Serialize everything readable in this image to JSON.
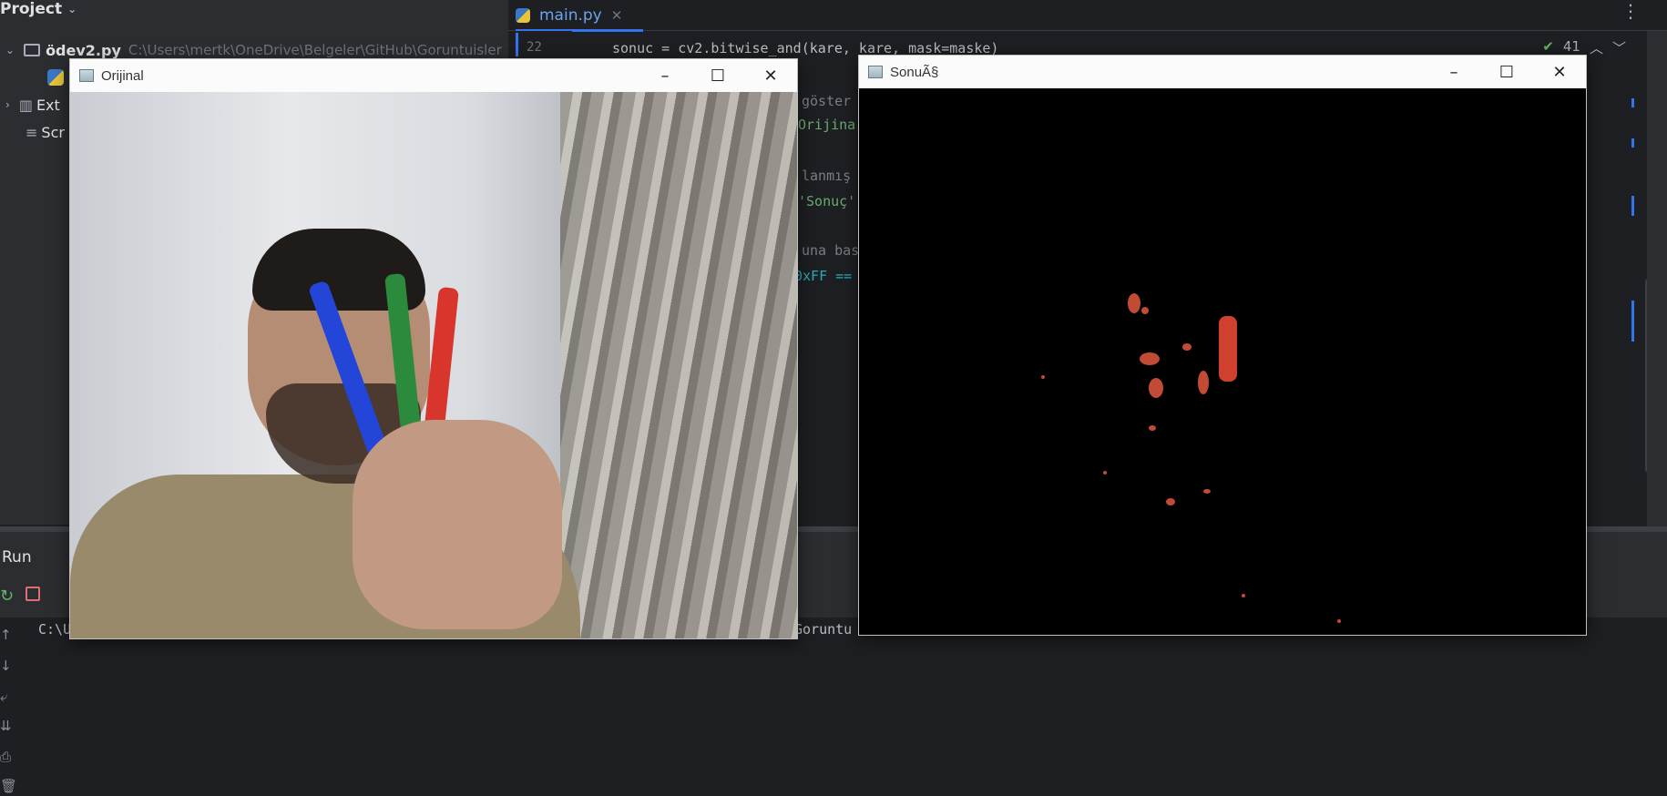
{
  "project": {
    "header": "Project",
    "root_name": "ödev2.py",
    "root_path": "C:\\Users\\mertk\\OneDrive\\Belgeler\\GitHub\\Goruntuisler",
    "ext_label": "Ext",
    "scr_label": "Scr"
  },
  "editor": {
    "tab_label": "main.py",
    "line_number": "22",
    "code_line": "sonuc = cv2.bitwise_and(kare, kare, mask=maske)",
    "inspection_count": "41",
    "fragments": [
      "göster",
      "Orijina",
      "lanmış",
      "'Sonuç'",
      "una bas",
      "0xFF =="
    ]
  },
  "run": {
    "title": "Run",
    "console_left": "C:\\U",
    "console_right": "Goruntu"
  },
  "windows": {
    "original": {
      "title": "Orijinal"
    },
    "result": {
      "title": "SonuÃ§"
    }
  },
  "colors": {
    "accent": "#3574f0",
    "run_green": "#5fb865",
    "stop_red": "#e06c75",
    "mask_red": "#c24b35"
  }
}
